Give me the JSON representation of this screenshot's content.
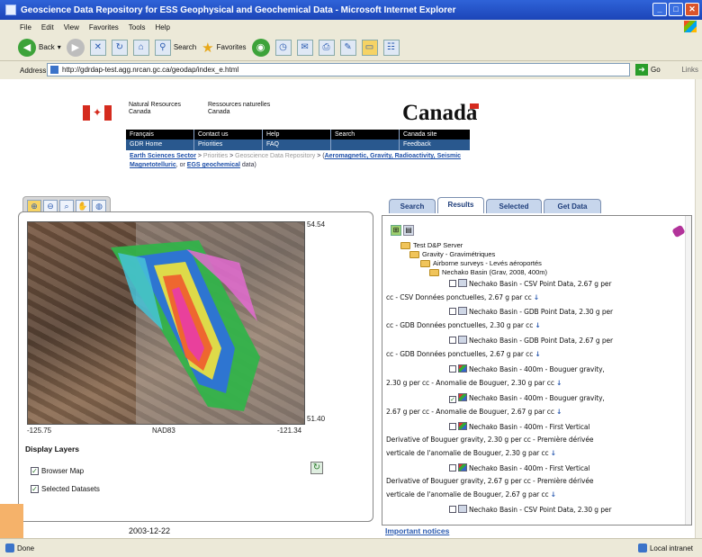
{
  "window": {
    "title": "Geoscience Data Repository for ESS Geophysical and Geochemical Data - Microsoft Internet Explorer",
    "menu": [
      "File",
      "Edit",
      "View",
      "Favorites",
      "Tools",
      "Help"
    ],
    "toolbar": {
      "back": "Back",
      "search": "Search",
      "favorites": "Favorites"
    },
    "address_label": "Address",
    "url": "http://gdrdap-test.agg.nrcan.gc.ca/geodap/index_e.html",
    "go": "Go",
    "links": "Links"
  },
  "header": {
    "dept_en": "Natural Resources Canada",
    "dept_fr": "Ressources naturelles Canada",
    "wordmark": "Canada",
    "nav_top": [
      "Français",
      "Contact us",
      "Help",
      "Search",
      "Canada site"
    ],
    "nav_bottom": [
      "GDR Home",
      "Priorities",
      "FAQ",
      "",
      "Feedback"
    ],
    "breadcrumb": {
      "l1": "Earth Sciences Sector",
      "sep1": " > ",
      "l2": "Priorities",
      "sep2": " > ",
      "l3": "Geoscience Data Repository",
      "sep3": " > (",
      "l4": "Aeromagnetic, Gravity, Radioactivity, Seismic Magnetotelluric",
      "sep4": ", or ",
      "l5": "EGS geochemical",
      "tail": " data)"
    }
  },
  "map": {
    "top_right": "54.54",
    "bottom_right": "51.40",
    "bottom_left": "-125.75",
    "datum": "NAD83",
    "bottom_right_lon": "-121.34",
    "layers_title": "Display Layers",
    "layers": [
      "Browser Map",
      "Selected Datasets"
    ],
    "date": "2003-12-22"
  },
  "tabs": [
    "Search",
    "Results",
    "Selected",
    "Get Data"
  ],
  "active_tab": "Results",
  "results": {
    "tree": [
      "Test D&P Server",
      "Gravity - Gravimétriques",
      "Airborne surveys - Levés aéroportés",
      "Nechako Basin (Grav, 2008, 400m)"
    ],
    "lines": [
      "Nechako Basin - CSV Point Data, 2.67 g per",
      "cc - CSV Données ponctuelles, 2.67 g par cc",
      "Nechako Basin - GDB Point Data, 2.30 g per",
      "cc - GDB Données ponctuelles, 2.30 g par cc",
      "Nechako Basin - GDB Point Data, 2.67 g per",
      "cc - GDB Données ponctuelles, 2.67 g par cc",
      "Nechako Basin - 400m - Bouguer gravity,",
      "2.30 g per cc - Anomalie de Bouguer, 2.30 g par cc",
      "Nechako Basin - 400m - Bouguer gravity,",
      "2.67 g per cc - Anomalie de Bouguer, 2.67 g par cc",
      "Nechako Basin - 400m - First Vertical",
      "Derivative of Bouguer gravity, 2.30 g per cc - Première dérivée",
      "verticale de l'anomalie de Bouguer, 2.30 g par cc",
      "Nechako Basin - 400m - First Vertical",
      "Derivative of Bouguer gravity, 2.67 g per cc - Première dérivée",
      "verticale de l'anomalie de Bouguer, 2.67 g par cc",
      "Nechako Basin - CSV Point Data, 2.30 g per"
    ],
    "important": "Important notices"
  },
  "status": {
    "left": "Done",
    "right": "Local intranet"
  }
}
